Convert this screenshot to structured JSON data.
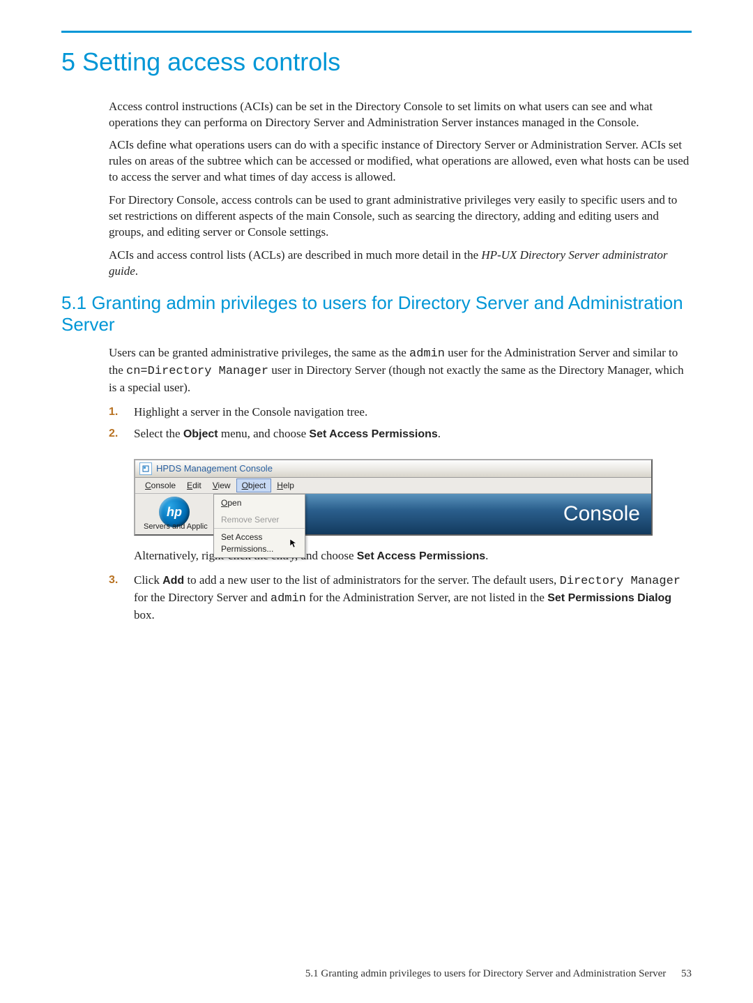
{
  "chapter": {
    "number": "5",
    "title": "Setting access controls"
  },
  "intro": {
    "p1": "Access control instructions (ACIs) can be set in the Directory Console to set limits on what users can see and what operations they can performa on Directory Server and Administration Server instances managed in the Console.",
    "p2": "ACIs define what operations users can do with a specific instance of Directory Server or Administration Server. ACIs set rules on areas of the subtree which can be accessed or modified, what operations are allowed, even what hosts can be used to access the server and what times of day access is allowed.",
    "p3": "For Directory Console, access controls can be used to grant administrative privileges very easily to specific users and to set restrictions on different aspects of the main Console, such as searcing the directory, adding and editing users and groups, and editing server or Console settings.",
    "p4_a": "ACIs and access control lists (ACLs) are described in much more detail in the ",
    "p4_i": "HP-UX Directory Server administrator guide",
    "p4_b": "."
  },
  "section": {
    "number": "5.1",
    "title": "Granting admin privileges to users for Directory Server and Administration Server",
    "p1_a": "Users can be granted administrative privileges, the same as the ",
    "p1_m1": "admin",
    "p1_b": " user for the Administration Server and similar to the ",
    "p1_m2": "cn=Directory Manager",
    "p1_c": " user in Directory Server (though not exactly the same as the Directory Manager, which is a special user)."
  },
  "steps": {
    "s1": {
      "n": "1.",
      "t": "Highlight a server in the Console navigation tree."
    },
    "s2": {
      "n": "2.",
      "t_a": "Select the ",
      "t_b1": "Object",
      "t_c": " menu, and choose ",
      "t_b2": "Set Access Permissions",
      "t_d": ".",
      "alt_a": "Alternatively, right-click the entry, and choose ",
      "alt_b": "Set Access Permissions",
      "alt_c": "."
    },
    "s3": {
      "n": "3.",
      "t_a": "Click ",
      "t_b1": "Add",
      "t_c": " to add a new user to the list of administrators for the server. The default users, ",
      "t_m1": "Directory Manager",
      "t_d": " for the Directory Server and ",
      "t_m2": "admin",
      "t_e": " for the Administration Server, are not listed in the ",
      "t_b2": "Set Permissions Dialog",
      "t_f": " box."
    }
  },
  "screenshot": {
    "window_title": "HPDS Management Console",
    "menus": {
      "console": {
        "k": "C",
        "rest": "onsole"
      },
      "edit": {
        "k": "E",
        "rest": "dit"
      },
      "view": {
        "k": "V",
        "rest": "iew"
      },
      "object": {
        "k": "O",
        "rest": "bject"
      },
      "help": {
        "k": "H",
        "rest": "elp"
      }
    },
    "hp_logo_text": "hp",
    "tree_label": "Servers and Applic",
    "dropdown": {
      "open": {
        "k": "O",
        "rest": "pen"
      },
      "remove": "Remove Server",
      "setacc": "Set Access Permissions..."
    },
    "banner": "Console"
  },
  "footer": {
    "text": "5.1 Granting admin privileges to users for Directory Server and Administration Server",
    "page": "53"
  }
}
